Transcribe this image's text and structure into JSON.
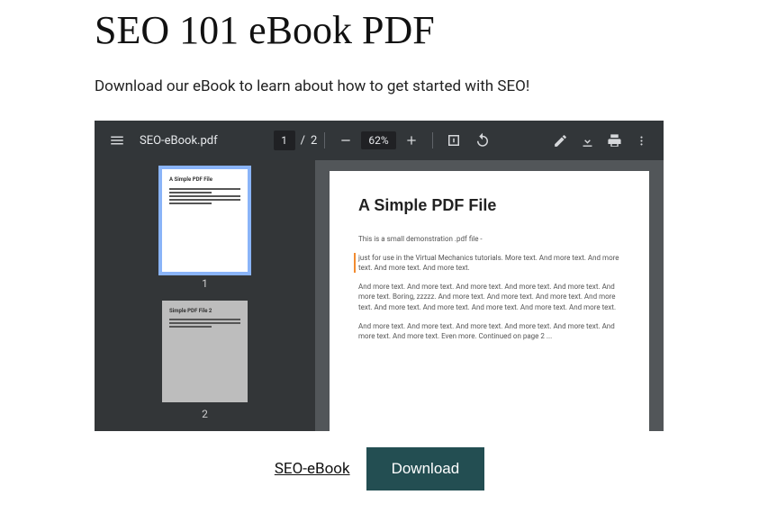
{
  "page": {
    "title": "SEO 101 eBook PDF",
    "subtitle": "Download our eBook to learn about how to get started with SEO!"
  },
  "pdf_toolbar": {
    "filename": "SEO-eBook.pdf",
    "current_page": "1",
    "page_separator": "/",
    "total_pages": "2",
    "zoom_level": "62%"
  },
  "pdf_sidebar": {
    "thumbs": [
      {
        "label": "1",
        "title": "A Simple PDF File"
      },
      {
        "label": "2",
        "title": "Simple PDF File 2"
      }
    ]
  },
  "pdf_document": {
    "title": "A Simple PDF File",
    "paragraphs": [
      "This is a small demonstration .pdf file -",
      "just for use in the Virtual Mechanics tutorials. More text. And more text. And more text. And more text. And more text.",
      "And more text. And more text. And more text. And more text. And more text. And more text. Boring, zzzzz. And more text. And more text. And more text. And more text. And more text. And more text. And more text. And more text. And more text.",
      "And more text. And more text. And more text. And more text. And more text. And more text. And more text. Even more. Continued on page 2 ..."
    ]
  },
  "download_row": {
    "file_link": "SEO-eBook",
    "download_button": "Download"
  }
}
